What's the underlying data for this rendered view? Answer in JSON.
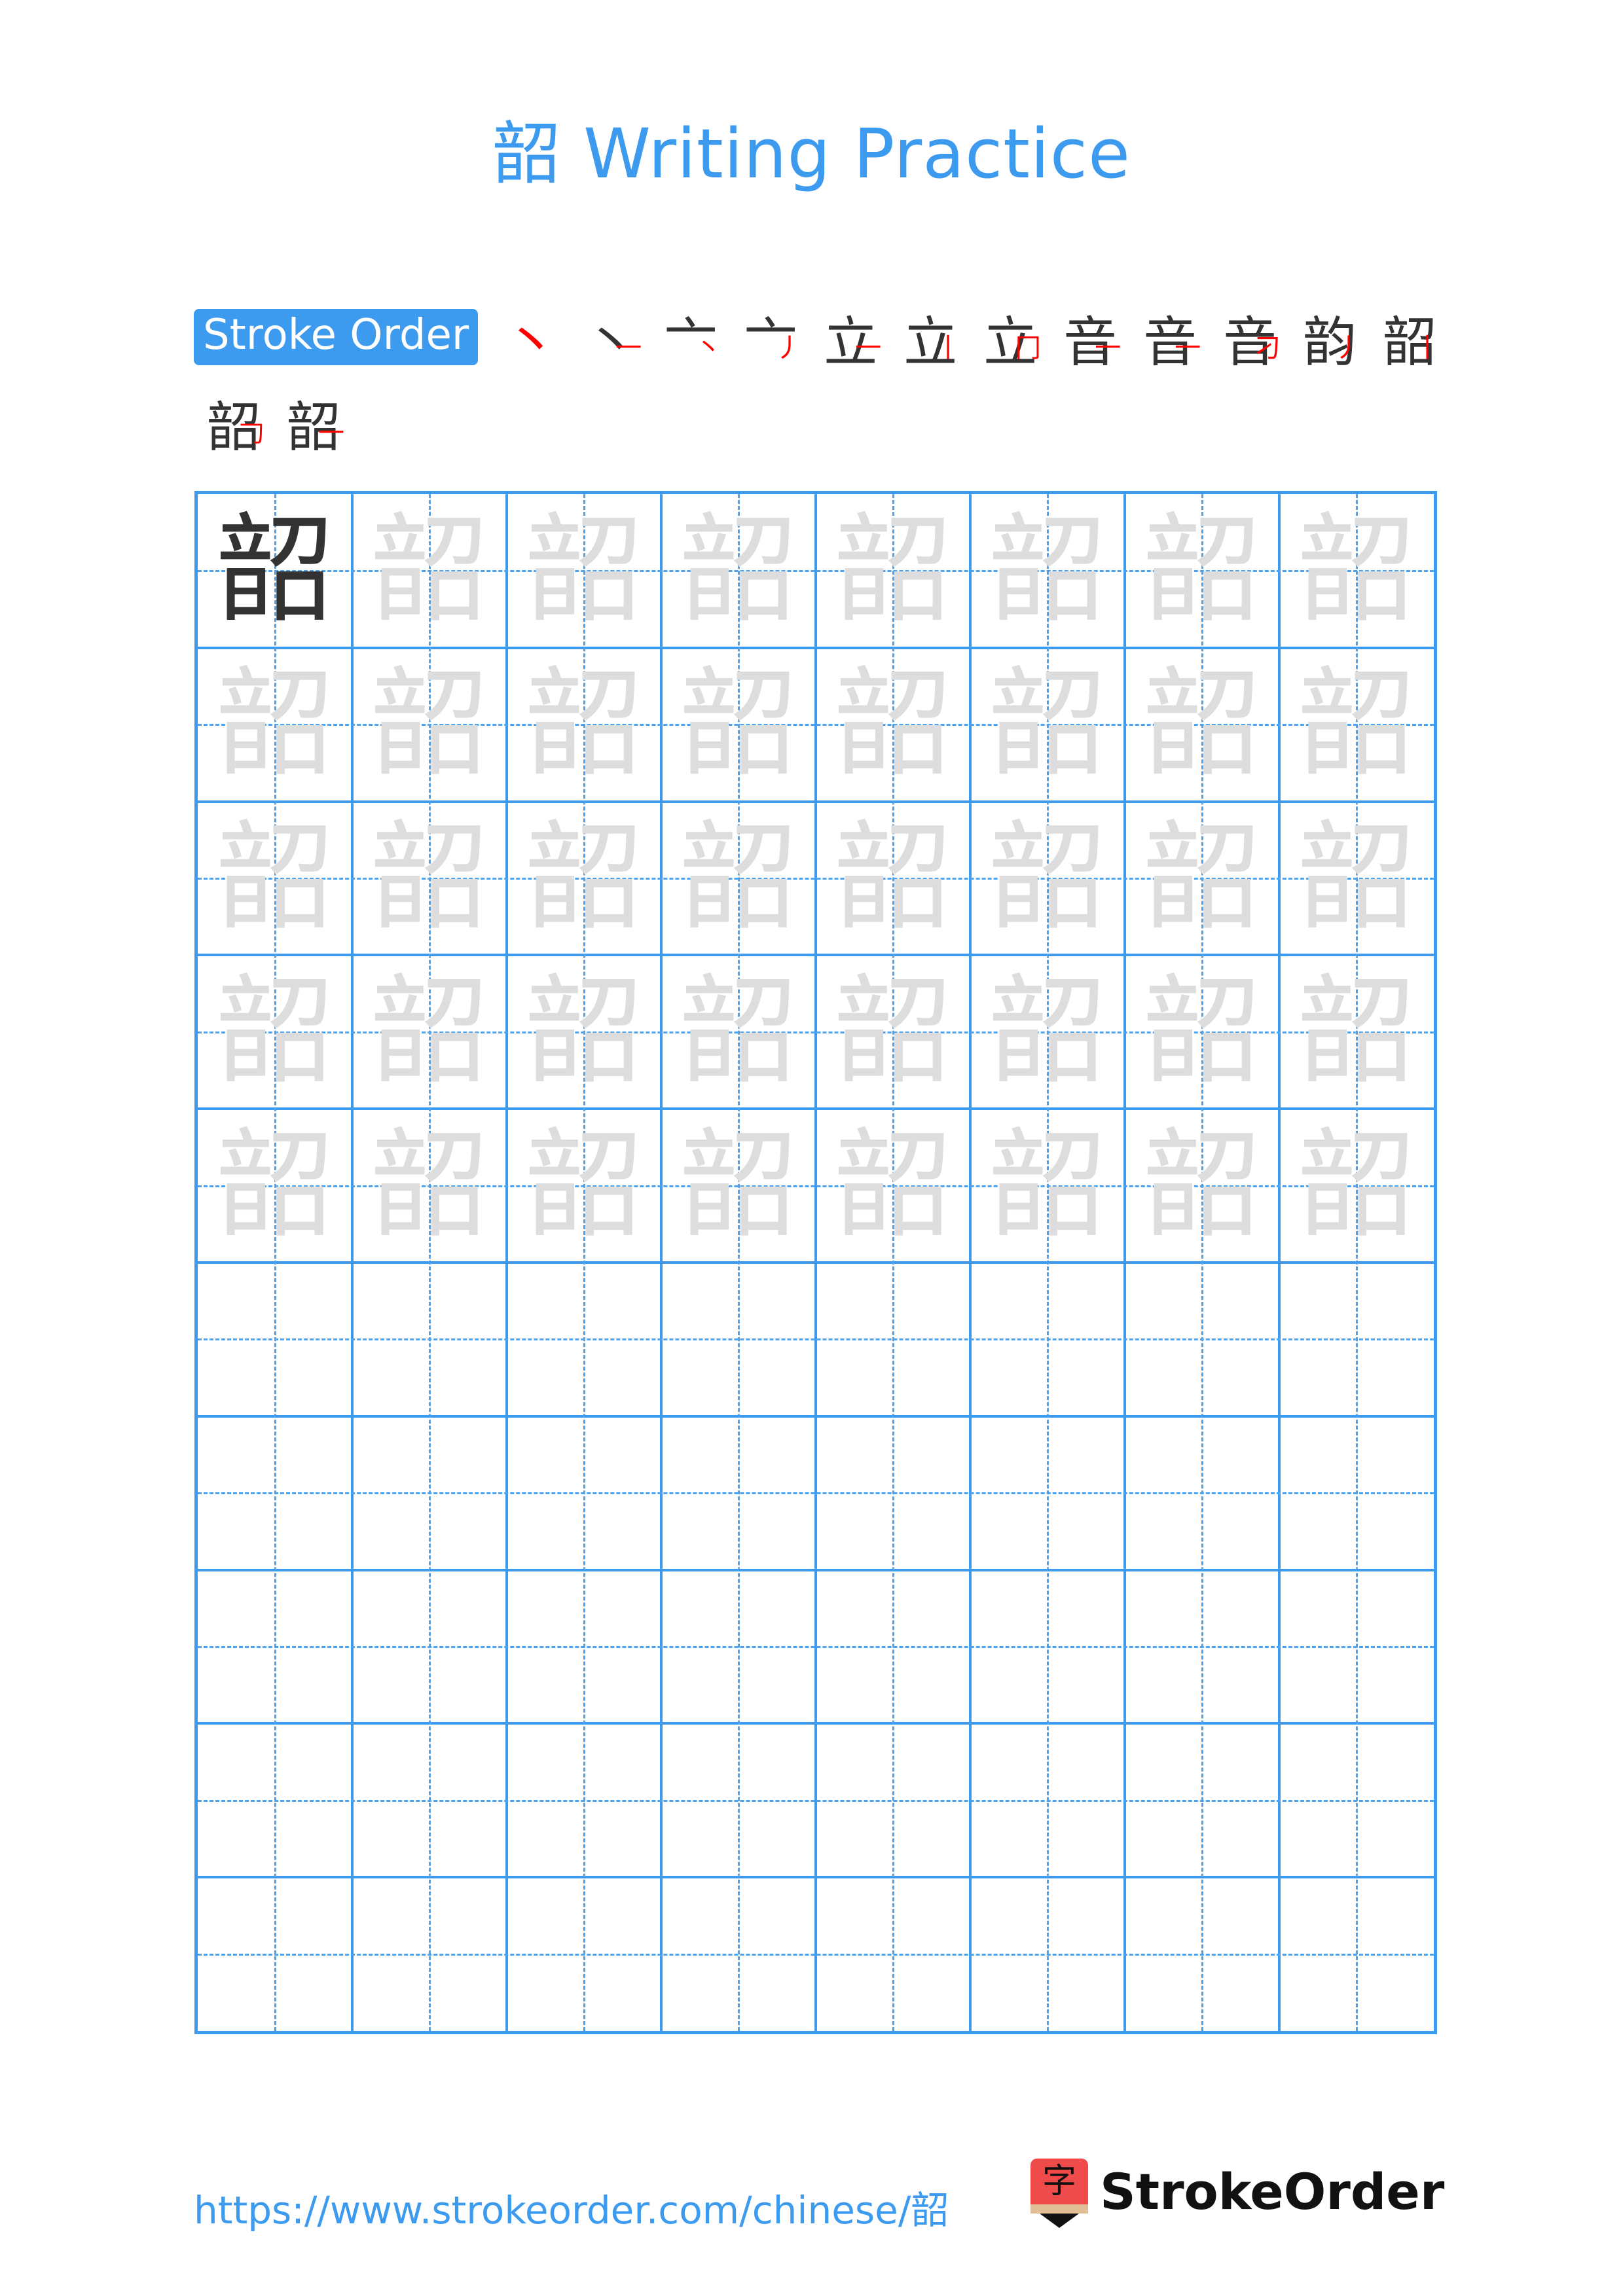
{
  "title": "韶 Writing Practice",
  "character": "韶",
  "stroke_order": {
    "label": "Stroke Order",
    "total_strokes": 14,
    "steps": [
      {
        "base": "",
        "new": "丶"
      },
      {
        "base": "丶",
        "new": "一"
      },
      {
        "base": "亠",
        "new": "丶"
      },
      {
        "base": "亠",
        "new": "丿"
      },
      {
        "base": "立",
        "new": "一"
      },
      {
        "base": "立",
        "new": "丨"
      },
      {
        "base": "立",
        "new": "冂"
      },
      {
        "base": "音",
        "new": "一"
      },
      {
        "base": "音",
        "new": "一"
      },
      {
        "base": "音",
        "new": "刁"
      },
      {
        "base": "韵",
        "new": "丿"
      },
      {
        "base": "韶",
        "new": "丨"
      },
      {
        "base": "韶",
        "new": "𠃌"
      },
      {
        "base": "韶",
        "new": "一"
      }
    ]
  },
  "grid": {
    "columns": 8,
    "rows": 10,
    "model_cells": 1,
    "trace_rows": 5,
    "line_color": "#3d9bef",
    "model_color": "#333333",
    "trace_color": "#dddddd"
  },
  "footer": {
    "url": "https://www.strokeorder.com/chinese/韶",
    "logo_icon_char": "字",
    "logo_text": "StrokeOrder"
  },
  "colors": {
    "accent": "#3d9bef",
    "stroke_highlight": "#ff0000",
    "logo_red": "#ef4b4b"
  }
}
